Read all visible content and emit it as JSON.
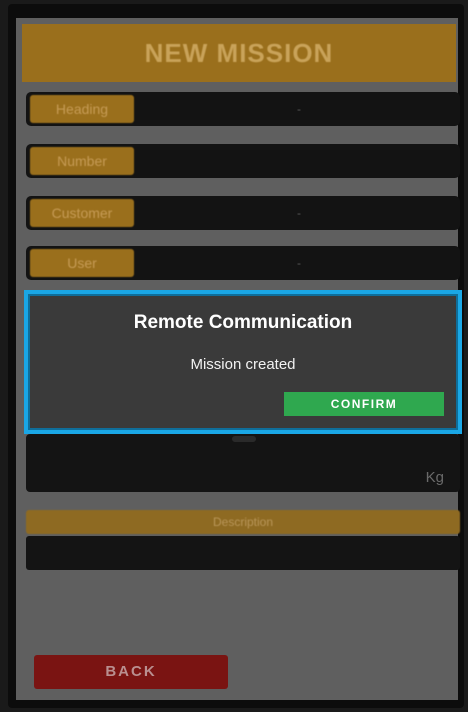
{
  "form": {
    "title": "NEW MISSION",
    "fields": [
      {
        "label": "Heading",
        "value": "-"
      },
      {
        "label": "Number",
        "value": ""
      },
      {
        "label": "Customer",
        "value": "-"
      },
      {
        "label": "User",
        "value": "-"
      }
    ],
    "weight_unit": "Kg",
    "section_label": "Description",
    "back_label": "BACK"
  },
  "dialog": {
    "title": "Remote Communication",
    "message": "Mission created",
    "confirm_label": "CONFIRM"
  },
  "colors": {
    "accent_orange": "#9a6f1c",
    "confirm_green": "#2fa84f",
    "back_red": "#7a1412",
    "highlight_blue": "#1aa7e6"
  }
}
